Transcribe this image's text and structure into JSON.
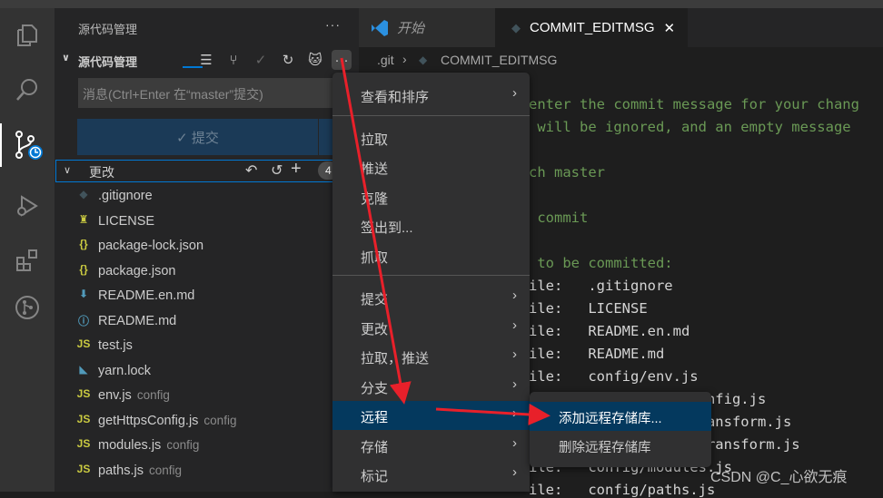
{
  "sidebar": {
    "title": "源代码管理",
    "more": "···",
    "section_label": "源代码管理",
    "message_placeholder": "消息(Ctrl+Enter 在“master”提交)",
    "commit_button": "✓ 提交",
    "changes_label": "更改",
    "changes_count": "4",
    "files": [
      {
        "name": ".gitignore",
        "dir": "",
        "icon": "git-icon",
        "color": "#41535b",
        "glyph": "◆"
      },
      {
        "name": "LICENSE",
        "dir": "",
        "icon": "license-icon",
        "color": "#cbcb41",
        "glyph": "♜"
      },
      {
        "name": "package-lock.json",
        "dir": "",
        "icon": "json-icon",
        "color": "#cbcb41",
        "glyph": "{}"
      },
      {
        "name": "package.json",
        "dir": "",
        "icon": "json-icon",
        "color": "#cbcb41",
        "glyph": "{}"
      },
      {
        "name": "README.en.md",
        "dir": "",
        "icon": "markdown-icon",
        "color": "#519aba",
        "glyph": "⬇"
      },
      {
        "name": "README.md",
        "dir": "",
        "icon": "info-icon",
        "color": "#519aba",
        "glyph": "ⓘ"
      },
      {
        "name": "test.js",
        "dir": "",
        "icon": "js-icon",
        "color": "#cbcb41",
        "glyph": "JS"
      },
      {
        "name": "yarn.lock",
        "dir": "",
        "icon": "yarn-icon",
        "color": "#519aba",
        "glyph": "◣"
      },
      {
        "name": "env.js",
        "dir": "config",
        "icon": "js-icon",
        "color": "#cbcb41",
        "glyph": "JS"
      },
      {
        "name": "getHttpsConfig.js",
        "dir": "config",
        "icon": "js-icon",
        "color": "#cbcb41",
        "glyph": "JS"
      },
      {
        "name": "modules.js",
        "dir": "config",
        "icon": "js-icon",
        "color": "#cbcb41",
        "glyph": "JS"
      },
      {
        "name": "paths.js",
        "dir": "config",
        "icon": "js-icon",
        "color": "#cbcb41",
        "glyph": "JS"
      }
    ]
  },
  "tabs": [
    {
      "label": "开始",
      "active": false
    },
    {
      "label": "COMMIT_EDITMSG",
      "active": true,
      "close": "✕"
    }
  ],
  "breadcrumb": {
    "folder": ".git",
    "sep": "›",
    "file": "COMMIT_EDITMSG"
  },
  "editor_lines": [
    {
      "text": "enter the commit message for your chang",
      "cls": "cm"
    },
    {
      "text": " will be ignored, and an empty message",
      "cls": "cm"
    },
    {
      "text": "",
      "cls": "cm"
    },
    {
      "text": "ch master",
      "cls": "cm"
    },
    {
      "text": "",
      "cls": "cm"
    },
    {
      "text": " commit",
      "cls": "cm"
    },
    {
      "text": "",
      "cls": "cm"
    },
    {
      "text": " to be committed:",
      "cls": "cm"
    },
    {
      "text": "ile:   .gitignore",
      "cls": "cv"
    },
    {
      "text": "ile:   LICENSE",
      "cls": "cv"
    },
    {
      "text": "ile:   README.en.md",
      "cls": "cv"
    },
    {
      "text": "ile:   README.md",
      "cls": "cv"
    },
    {
      "text": "ile:   config/env.js",
      "cls": "cv"
    },
    {
      "text": "                 psConfig.js",
      "cls": "cv"
    },
    {
      "text": "                 ssTransform.js",
      "cls": "cv"
    },
    {
      "text": "                 ileTransform.js",
      "cls": "cv"
    },
    {
      "text": "ile:   config/modules.js",
      "cls": "cv"
    },
    {
      "text": "ile:   config/paths.js",
      "cls": "cv"
    }
  ],
  "menu": {
    "items": [
      {
        "label": "查看和排序",
        "submenu": true
      },
      {
        "sep": true
      },
      {
        "label": "拉取"
      },
      {
        "label": "推送"
      },
      {
        "label": "克隆"
      },
      {
        "label": "签出到..."
      },
      {
        "label": "抓取"
      },
      {
        "sep": true
      },
      {
        "label": "提交",
        "submenu": true
      },
      {
        "label": "更改",
        "submenu": true
      },
      {
        "label": "拉取，推送",
        "submenu": true
      },
      {
        "label": "分支",
        "submenu": true
      },
      {
        "label": "远程",
        "submenu": true,
        "highlighted": true
      },
      {
        "label": "存储",
        "submenu": true
      },
      {
        "label": "标记",
        "submenu": true
      }
    ],
    "submenu": [
      {
        "label": "添加远程存储库...",
        "highlighted": true
      },
      {
        "label": "删除远程存储库"
      }
    ]
  },
  "watermark": "CSDN @C_心欲无痕",
  "colors": {
    "accent": "#0078d4",
    "highlight": "#04395e",
    "annotation_arrow": "#e8202a"
  }
}
